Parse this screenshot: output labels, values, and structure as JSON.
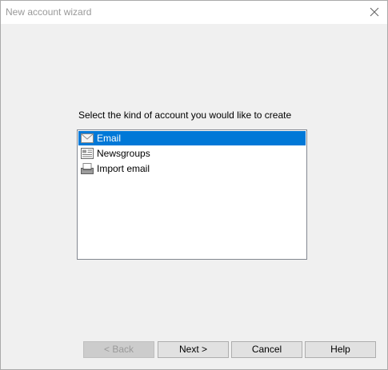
{
  "window": {
    "title": "New account wizard"
  },
  "prompt": "Select the kind of account you would like to create",
  "account_types": [
    {
      "label": "Email",
      "icon": "envelope-icon",
      "selected": true
    },
    {
      "label": "Newsgroups",
      "icon": "newsgroup-icon",
      "selected": false
    },
    {
      "label": "Import email",
      "icon": "import-tray-icon",
      "selected": false
    }
  ],
  "buttons": {
    "back": "< Back",
    "next": "Next >",
    "cancel": "Cancel",
    "help": "Help"
  },
  "colors": {
    "selection": "#0078d7",
    "window_bg": "#f0f0f0",
    "button_bg": "#e1e1e1"
  }
}
